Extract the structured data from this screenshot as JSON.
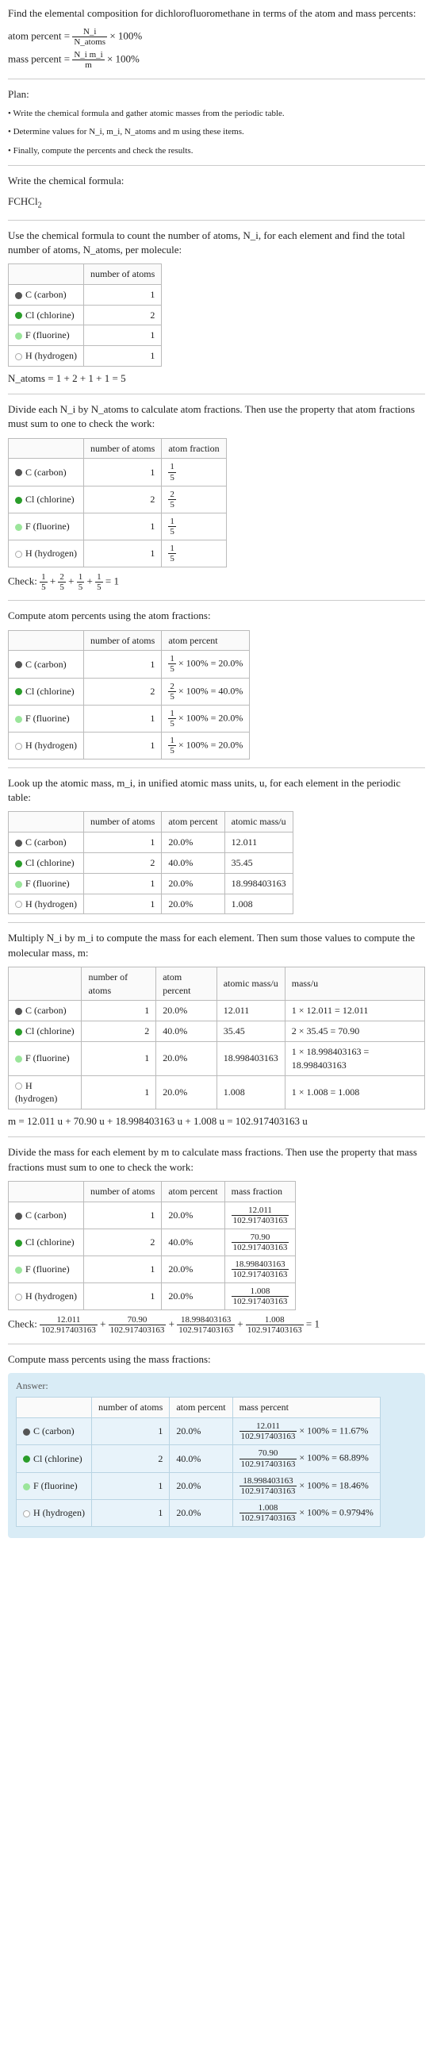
{
  "intro": {
    "line1": "Find the elemental composition for dichlorofluoromethane in terms of the atom and mass percents:",
    "ap_label": "atom percent =",
    "ap_frac_n": "N_i",
    "ap_frac_d": "N_atoms",
    "ap_tail": "× 100%",
    "mp_label": "mass percent =",
    "mp_frac_n": "N_i m_i",
    "mp_frac_d": "m",
    "mp_tail": "× 100%"
  },
  "plan": {
    "heading": "Plan:",
    "b1": "• Write the chemical formula and gather atomic masses from the periodic table.",
    "b2": "• Determine values for N_i, m_i, N_atoms and m using these items.",
    "b3": "• Finally, compute the percents and check the results."
  },
  "formula_sec": {
    "heading": "Write the chemical formula:",
    "formula": "FCHCl",
    "formula_sub": "2"
  },
  "count_sec": {
    "heading": "Use the chemical formula to count the number of atoms, N_i, for each element and find the total number of atoms, N_atoms, per molecule:",
    "col_num": "number of atoms",
    "rows": {
      "c": {
        "el": "C (carbon)",
        "n": "1"
      },
      "cl": {
        "el": "Cl (chlorine)",
        "n": "2"
      },
      "f": {
        "el": "F (fluorine)",
        "n": "1"
      },
      "h": {
        "el": "H (hydrogen)",
        "n": "1"
      }
    },
    "natoms": "N_atoms = 1 + 2 + 1 + 1 = 5"
  },
  "atomfrac_sec": {
    "heading": "Divide each N_i by N_atoms to calculate atom fractions. Then use the property that atom fractions must sum to one to check the work:",
    "col_num": "number of atoms",
    "col_frac": "atom fraction",
    "rows": {
      "c": {
        "el": "C (carbon)",
        "n": "1",
        "fn": "1",
        "fd": "5"
      },
      "cl": {
        "el": "Cl (chlorine)",
        "n": "2",
        "fn": "2",
        "fd": "5"
      },
      "f": {
        "el": "F (fluorine)",
        "n": "1",
        "fn": "1",
        "fd": "5"
      },
      "h": {
        "el": "H (hydrogen)",
        "n": "1",
        "fn": "1",
        "fd": "5"
      }
    },
    "check_label": "Check: ",
    "check_tail": " = 1"
  },
  "atompct_sec": {
    "heading": "Compute atom percents using the atom fractions:",
    "col_num": "number of atoms",
    "col_pct": "atom percent",
    "rows": {
      "c": {
        "el": "C (carbon)",
        "n": "1",
        "fn": "1",
        "fd": "5",
        "pct": "× 100% = 20.0%"
      },
      "cl": {
        "el": "Cl (chlorine)",
        "n": "2",
        "fn": "2",
        "fd": "5",
        "pct": "× 100% = 40.0%"
      },
      "f": {
        "el": "F (fluorine)",
        "n": "1",
        "fn": "1",
        "fd": "5",
        "pct": "× 100% = 20.0%"
      },
      "h": {
        "el": "H (hydrogen)",
        "n": "1",
        "fn": "1",
        "fd": "5",
        "pct": "× 100% = 20.0%"
      }
    }
  },
  "mass_lookup_sec": {
    "heading": "Look up the atomic mass, m_i, in unified atomic mass units, u, for each element in the periodic table:",
    "col_num": "number of atoms",
    "col_pct": "atom percent",
    "col_mass": "atomic mass/u",
    "rows": {
      "c": {
        "el": "C (carbon)",
        "n": "1",
        "pct": "20.0%",
        "m": "12.011"
      },
      "cl": {
        "el": "Cl (chlorine)",
        "n": "2",
        "pct": "40.0%",
        "m": "35.45"
      },
      "f": {
        "el": "F (fluorine)",
        "n": "1",
        "pct": "20.0%",
        "m": "18.998403163"
      },
      "h": {
        "el": "H (hydrogen)",
        "n": "1",
        "pct": "20.0%",
        "m": "1.008"
      }
    }
  },
  "mult_sec": {
    "heading": "Multiply N_i by m_i to compute the mass for each element. Then sum those values to compute the molecular mass, m:",
    "col_num": "number of atoms",
    "col_pct": "atom percent",
    "col_mass": "atomic mass/u",
    "col_massu": "mass/u",
    "rows": {
      "c": {
        "el": "C (carbon)",
        "n": "1",
        "pct": "20.0%",
        "m": "12.011",
        "mu": "1 × 12.011 = 12.011"
      },
      "cl": {
        "el": "Cl (chlorine)",
        "n": "2",
        "pct": "40.0%",
        "m": "35.45",
        "mu": "2 × 35.45 = 70.90"
      },
      "f": {
        "el": "F (fluorine)",
        "n": "1",
        "pct": "20.0%",
        "m": "18.998403163",
        "mu": "1 × 18.998403163 = 18.998403163"
      },
      "h": {
        "el": "H (hydrogen)",
        "n": "1",
        "pct": "20.0%",
        "m": "1.008",
        "mu": "1 × 1.008 = 1.008"
      }
    },
    "msum": "m = 12.011 u + 70.90 u + 18.998403163 u + 1.008 u = 102.917403163 u"
  },
  "massfrac_sec": {
    "heading": "Divide the mass for each element by m to calculate mass fractions. Then use the property that mass fractions must sum to one to check the work:",
    "col_num": "number of atoms",
    "col_pct": "atom percent",
    "col_mfrac": "mass fraction",
    "rows": {
      "c": {
        "el": "C (carbon)",
        "n": "1",
        "pct": "20.0%",
        "fn": "12.011",
        "fd": "102.917403163"
      },
      "cl": {
        "el": "Cl (chlorine)",
        "n": "2",
        "pct": "40.0%",
        "fn": "70.90",
        "fd": "102.917403163"
      },
      "f": {
        "el": "F (fluorine)",
        "n": "1",
        "pct": "20.0%",
        "fn": "18.998403163",
        "fd": "102.917403163"
      },
      "h": {
        "el": "H (hydrogen)",
        "n": "1",
        "pct": "20.0%",
        "fn": "1.008",
        "fd": "102.917403163"
      }
    },
    "check_label": "Check: ",
    "check_tail": " = 1"
  },
  "masspct_sec": {
    "heading": "Compute mass percents using the mass fractions:"
  },
  "answer": {
    "label": "Answer:",
    "col_num": "number of atoms",
    "col_pct": "atom percent",
    "col_mpct": "mass percent",
    "rows": {
      "c": {
        "el": "C (carbon)",
        "n": "1",
        "pct": "20.0%",
        "fn": "12.011",
        "fd": "102.917403163",
        "tail": "× 100% = 11.67%"
      },
      "cl": {
        "el": "Cl (chlorine)",
        "n": "2",
        "pct": "40.0%",
        "fn": "70.90",
        "fd": "102.917403163",
        "tail": "× 100% = 68.89%"
      },
      "f": {
        "el": "F (fluorine)",
        "n": "1",
        "pct": "20.0%",
        "fn": "18.998403163",
        "fd": "102.917403163",
        "tail": "× 100% = 18.46%"
      },
      "h": {
        "el": "H (hydrogen)",
        "n": "1",
        "pct": "20.0%",
        "fn": "1.008",
        "fd": "102.917403163",
        "tail": "× 100% = 0.9794%"
      }
    }
  }
}
